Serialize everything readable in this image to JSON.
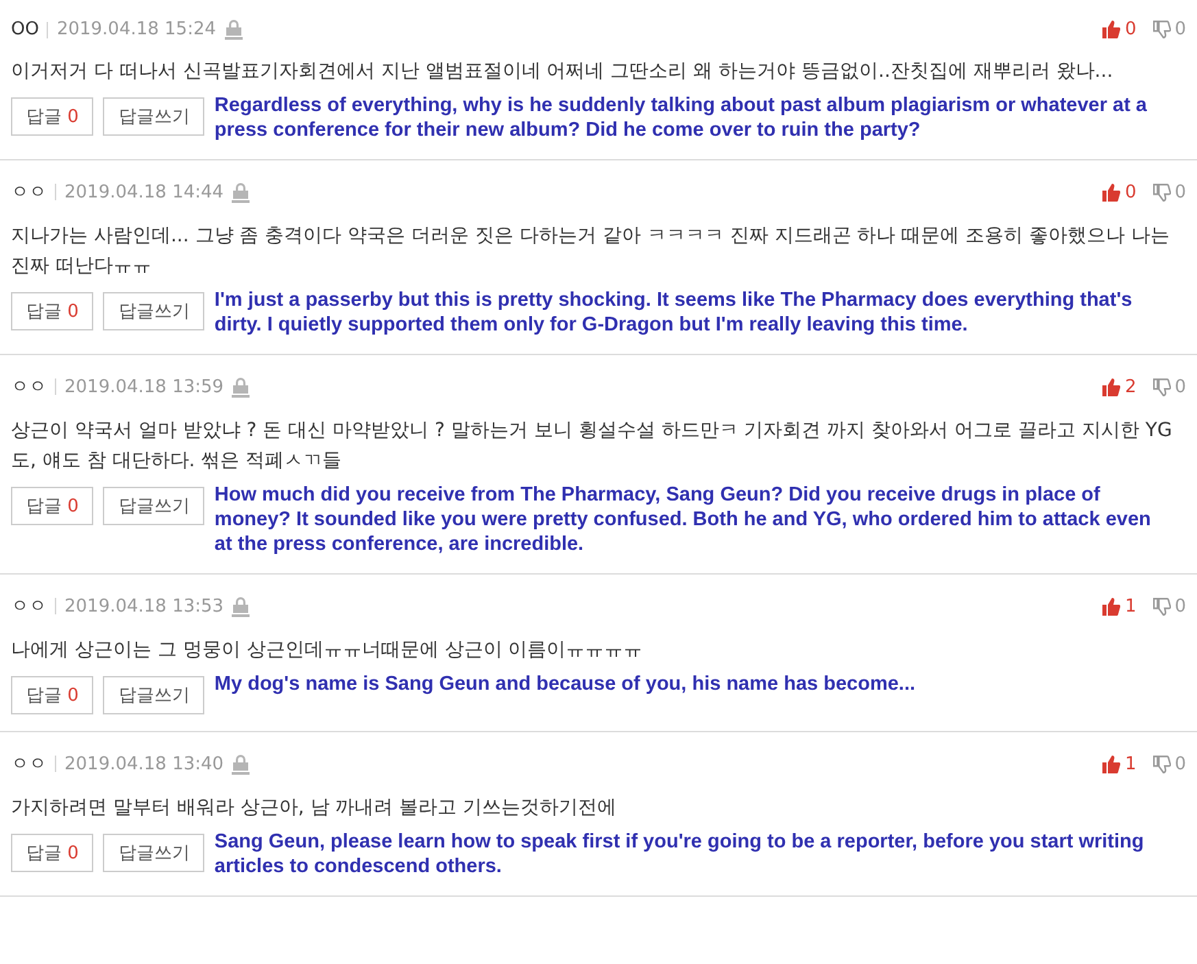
{
  "comments": [
    {
      "author": "OO",
      "date": "2019.04.18 15:24",
      "likes": "0",
      "dislikes": "0",
      "text": "이거저거 다 떠나서 신곡발표기자회견에서 지난 앨범표절이네 어쩌네 그딴소리 왜 하는거야 뜽금없이..잔칫집에 재뿌리러 왔나...",
      "reply_label": "답글",
      "reply_count": "0",
      "write_label": "답글쓰기",
      "translation": "Regardless of everything, why is he suddenly talking about past album plagiarism or whatever at a press conference for their new album? Did he come over to ruin the party?"
    },
    {
      "author": "ㅇㅇ",
      "date": "2019.04.18 14:44",
      "likes": "0",
      "dislikes": "0",
      "text": "지나가는 사람인데... 그냥 좀 충격이다 약국은 더러운 짓은 다하는거 같아 ㅋㅋㅋㅋ 진짜 지드래곤 하나 때문에 조용히 좋아했으나 나는 진짜 떠난다ㅠㅠ",
      "reply_label": "답글",
      "reply_count": "0",
      "write_label": "답글쓰기",
      "translation": "I'm just a passerby but this is pretty shocking. It seems like The Pharmacy does everything that's dirty. I quietly supported them only for G-Dragon but I'm really leaving this time."
    },
    {
      "author": "ㅇㅇ",
      "date": "2019.04.18 13:59",
      "likes": "2",
      "dislikes": "0",
      "text": "상근이 약국서 얼마 받았냐 ? 돈 대신 마약받았니 ? 말하는거 보니 횡설수설 하드만ㅋ 기자회견 까지 찾아와서 어그로 끌라고 지시한 YG도, 얘도 참 대단하다. 썪은 적폐ㅅㄲ들",
      "reply_label": "답글",
      "reply_count": "0",
      "write_label": "답글쓰기",
      "translation": "How much did you receive from The Pharmacy, Sang Geun? Did you receive drugs in place of money? It sounded like you were pretty confused. Both he and YG, who ordered him to attack even at the press conference, are incredible."
    },
    {
      "author": "ㅇㅇ",
      "date": "2019.04.18 13:53",
      "likes": "1",
      "dislikes": "0",
      "text": "나에게 상근이는 그 멍뭉이 상근인데ㅠㅠ너때문에 상근이 이름이ㅠㅠㅠㅠ",
      "reply_label": "답글",
      "reply_count": "0",
      "write_label": "답글쓰기",
      "translation": "My dog's name is Sang Geun and because of you, his name has become..."
    },
    {
      "author": "ㅇㅇ",
      "date": "2019.04.18 13:40",
      "likes": "1",
      "dislikes": "0",
      "text": "가지하려면 말부터 배워라 상근아, 남 까내려 볼라고 기쓰는것하기전에",
      "reply_label": "답글",
      "reply_count": "0",
      "write_label": "답글쓰기",
      "translation": "Sang Geun, please learn how to speak first if you're going to be a reporter, before you start writing articles to condescend others."
    }
  ]
}
